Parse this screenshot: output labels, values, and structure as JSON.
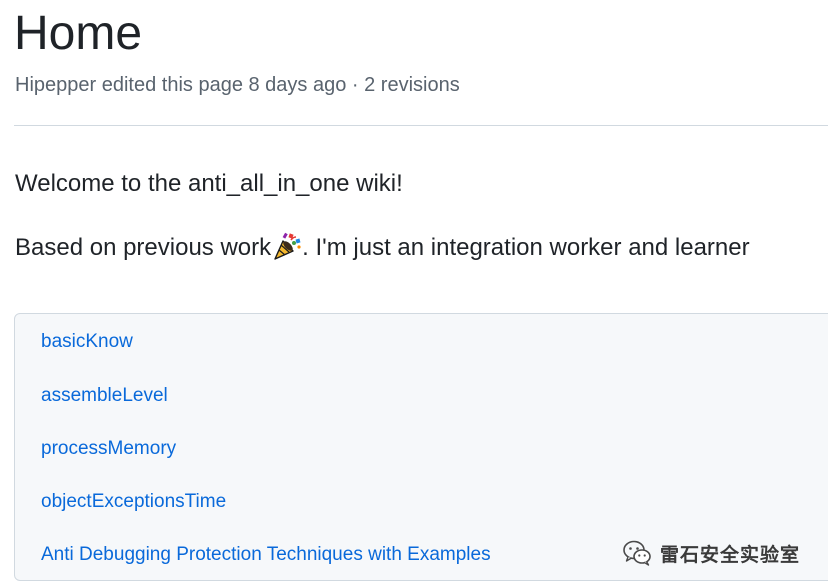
{
  "page": {
    "title": "Home",
    "meta": "Hipepper edited this page 8 days ago · 2 revisions"
  },
  "content": {
    "welcome": "Welcome to the anti_all_in_one wiki!",
    "based_before": "Based on previous work",
    "based_after": ". I'm just an integration worker and learner",
    "emoji_icon": "party-popper-icon"
  },
  "sidebar": {
    "links": [
      {
        "label": "basicKnow"
      },
      {
        "label": "assembleLevel"
      },
      {
        "label": "processMemory"
      },
      {
        "label": "objectExceptionsTime"
      },
      {
        "label": "Anti Debugging Protection Techniques with Examples"
      }
    ]
  },
  "watermark": {
    "text": "雷石安全实验室",
    "icon": "wechat-icon"
  },
  "colors": {
    "link": "#0969da",
    "muted_text": "#59636e",
    "sidebar_bg": "#f6f8fa",
    "border": "#d1d9e0"
  }
}
